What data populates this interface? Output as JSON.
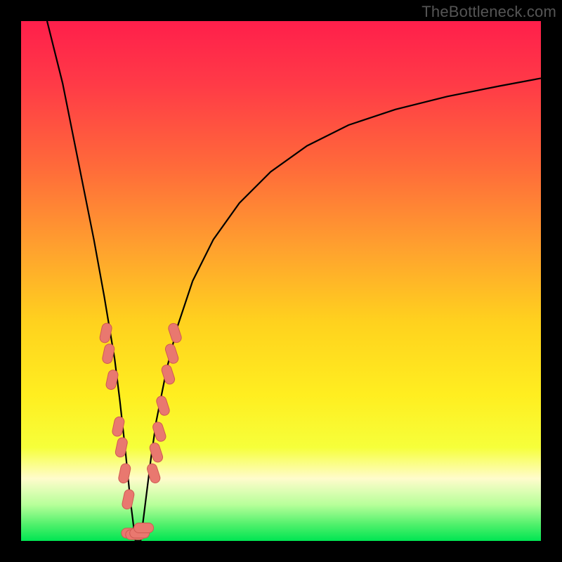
{
  "watermark": "TheBottleneck.com",
  "colors": {
    "frame": "#000000",
    "gradient_stops": [
      {
        "offset": 0.0,
        "color": "#ff1f4b"
      },
      {
        "offset": 0.12,
        "color": "#ff3a47"
      },
      {
        "offset": 0.28,
        "color": "#ff6a3a"
      },
      {
        "offset": 0.44,
        "color": "#ffa22e"
      },
      {
        "offset": 0.58,
        "color": "#ffd21e"
      },
      {
        "offset": 0.72,
        "color": "#ffee20"
      },
      {
        "offset": 0.82,
        "color": "#f6ff3a"
      },
      {
        "offset": 0.88,
        "color": "#fffccc"
      },
      {
        "offset": 0.93,
        "color": "#b8ff9a"
      },
      {
        "offset": 0.97,
        "color": "#4cf06a"
      },
      {
        "offset": 1.0,
        "color": "#00e552"
      }
    ],
    "curve": "#000000",
    "marker_fill": "#e9786f",
    "marker_stroke": "#cf5a52"
  },
  "chart_data": {
    "type": "line",
    "title": "",
    "xlabel": "",
    "ylabel": "",
    "xlim": [
      0,
      100
    ],
    "ylim": [
      0,
      100
    ],
    "optimum_x": 22,
    "series": [
      {
        "name": "bottleneck-curve",
        "x": [
          5,
          8,
          10,
          12,
          14,
          16,
          18,
          19,
          20,
          21,
          22,
          23,
          24,
          25,
          26,
          28,
          30,
          33,
          37,
          42,
          48,
          55,
          63,
          72,
          82,
          92,
          100
        ],
        "y": [
          100,
          88,
          78,
          68,
          58,
          47,
          35,
          27,
          18,
          8,
          0,
          0,
          8,
          16,
          23,
          33,
          41,
          50,
          58,
          65,
          71,
          76,
          80,
          83,
          85.5,
          87.5,
          89
        ]
      }
    ],
    "markers": {
      "left": [
        {
          "x": 16.3,
          "y": 40
        },
        {
          "x": 16.8,
          "y": 36
        },
        {
          "x": 17.5,
          "y": 31
        },
        {
          "x": 18.7,
          "y": 22
        },
        {
          "x": 19.3,
          "y": 18
        },
        {
          "x": 19.9,
          "y": 13
        },
        {
          "x": 20.6,
          "y": 8
        }
      ],
      "right": [
        {
          "x": 25.5,
          "y": 13
        },
        {
          "x": 26.0,
          "y": 17
        },
        {
          "x": 26.6,
          "y": 21
        },
        {
          "x": 27.3,
          "y": 26
        },
        {
          "x": 28.3,
          "y": 32
        },
        {
          "x": 29.0,
          "y": 36
        },
        {
          "x": 29.6,
          "y": 40
        }
      ],
      "bottom": [
        {
          "x": 21.2,
          "y": 1.5
        },
        {
          "x": 22.0,
          "y": 1.2
        },
        {
          "x": 22.8,
          "y": 1.5
        },
        {
          "x": 23.6,
          "y": 2.5
        }
      ]
    }
  }
}
